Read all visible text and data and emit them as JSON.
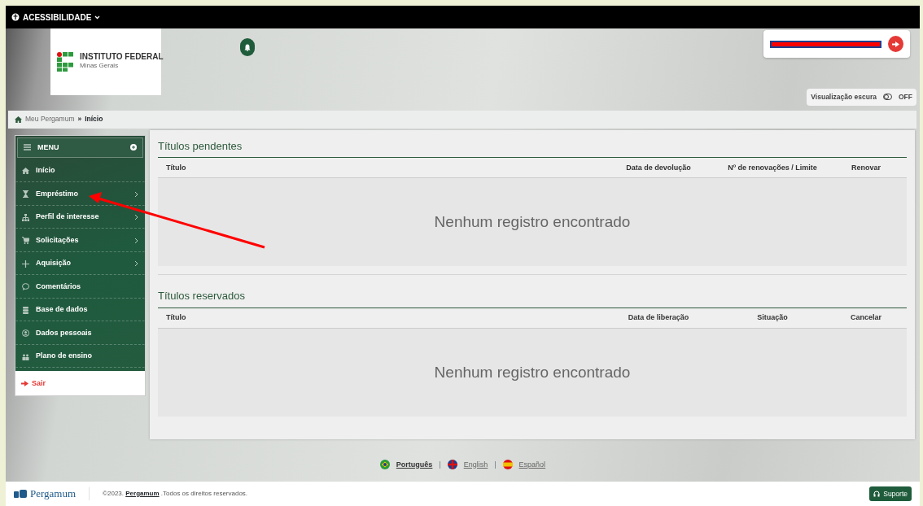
{
  "accessibility_menu": {
    "label": "ACESSIBILIDADE"
  },
  "logo": {
    "title": "INSTITUTO FEDERAL",
    "subtitle": "Minas Gerais"
  },
  "user": {
    "name_redacted": true
  },
  "dark_mode": {
    "label": "Visualização escura",
    "state": "OFF",
    "on": false
  },
  "breadcrumb": {
    "items": [
      "Meu Pergamum",
      "Início"
    ],
    "separator": "»"
  },
  "menu": {
    "title": "MENU",
    "items": [
      {
        "label": "Início",
        "has_submenu": false
      },
      {
        "label": "Empréstimo",
        "has_submenu": true
      },
      {
        "label": "Perfil de interesse",
        "has_submenu": true
      },
      {
        "label": "Solicitações",
        "has_submenu": true
      },
      {
        "label": "Aquisição",
        "has_submenu": true
      },
      {
        "label": "Comentários",
        "has_submenu": false
      },
      {
        "label": "Base de dados",
        "has_submenu": false
      },
      {
        "label": "Dados pessoais",
        "has_submenu": false
      },
      {
        "label": "Plano de ensino",
        "has_submenu": false
      }
    ],
    "logout": "Sair"
  },
  "sections": [
    {
      "title": "Títulos pendentes",
      "columns": [
        "Título",
        "Data de devolução",
        "Nº de renovações / Limite",
        "Renovar"
      ],
      "empty_text": "Nenhum registro encontrado"
    },
    {
      "title": "Títulos reservados",
      "columns": [
        "Título",
        "Data de liberação",
        "Situação",
        "Cancelar"
      ],
      "empty_text": "Nenhum registro encontrado"
    }
  ],
  "language_bar": {
    "separator": "|",
    "languages": [
      {
        "label": "Português",
        "selected": true
      },
      {
        "label": "English",
        "selected": false
      },
      {
        "label": "Español",
        "selected": false
      }
    ]
  },
  "footer": {
    "brand": "Pergamum",
    "copyright": "©2023.",
    "copyright_link": "Pergamum",
    "rights": ".Todos os direitos reservados.",
    "support": "Suporte"
  }
}
